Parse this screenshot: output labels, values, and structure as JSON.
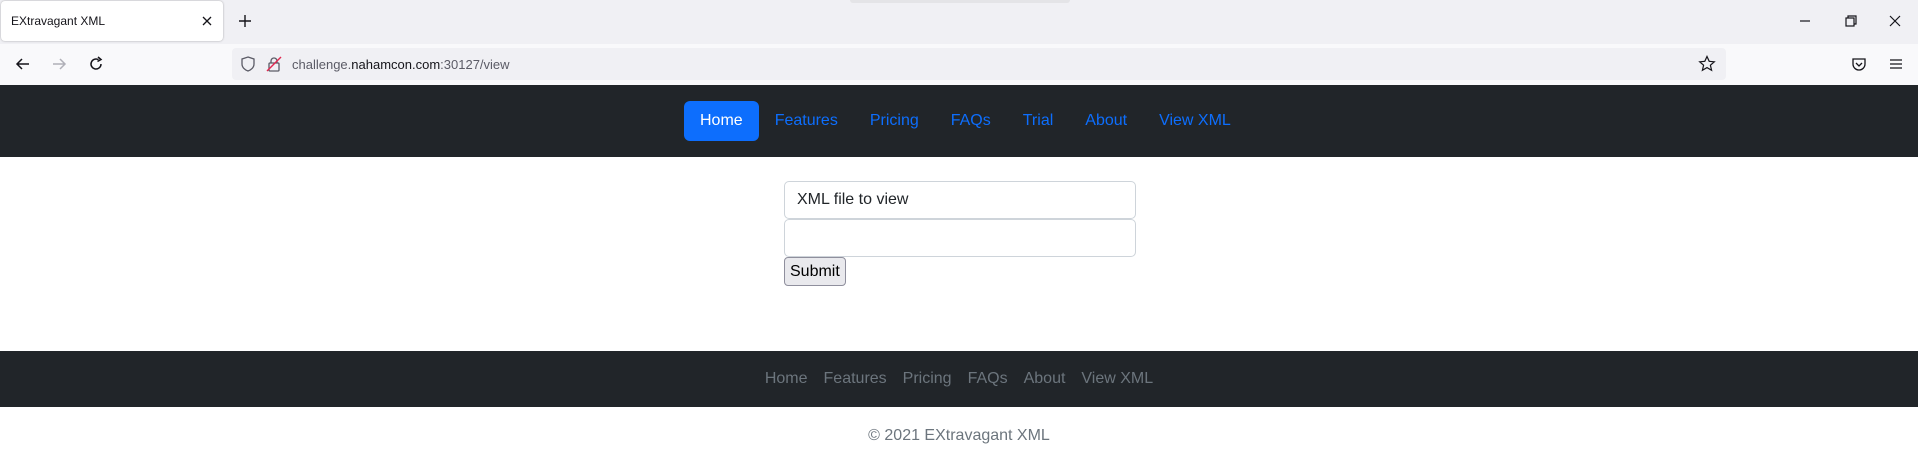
{
  "browser": {
    "tab": {
      "title": "EXtravagant XML"
    },
    "url": {
      "prefix": "challenge.",
      "domain": "nahamcon.com",
      "suffix": ":30127/view"
    }
  },
  "nav": {
    "items": [
      {
        "label": "Home",
        "active": true
      },
      {
        "label": "Features"
      },
      {
        "label": "Pricing"
      },
      {
        "label": "FAQs"
      },
      {
        "label": "Trial"
      },
      {
        "label": "About"
      },
      {
        "label": "View XML"
      }
    ]
  },
  "form": {
    "label": "XML file to view",
    "input_value": "",
    "submit_label": "Submit"
  },
  "footer": {
    "links": [
      "Home",
      "Features",
      "Pricing",
      "FAQs",
      "About",
      "View XML"
    ],
    "copyright": "© 2021 EXtravagant XML"
  },
  "colors": {
    "navbar_bg": "#212529",
    "primary": "#0d6efd",
    "muted": "#6c757d"
  }
}
